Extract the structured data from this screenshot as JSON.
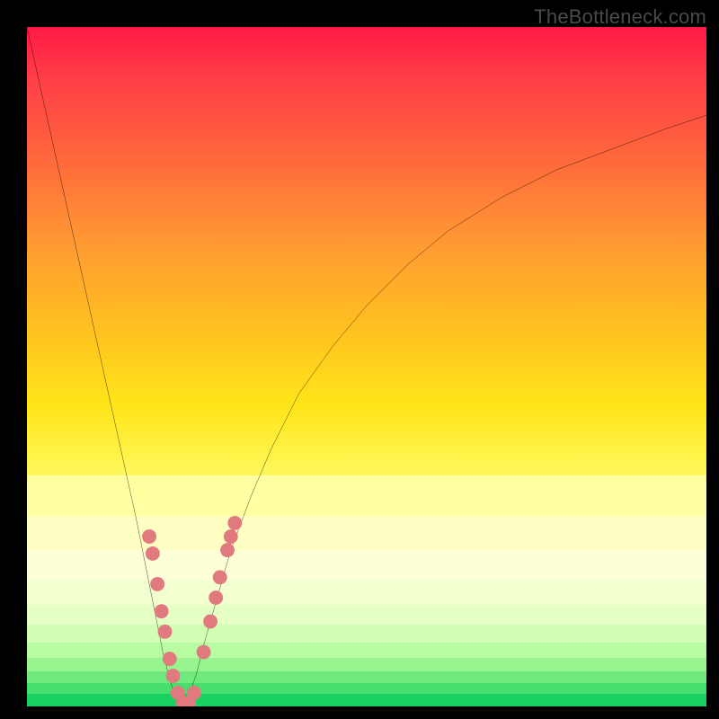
{
  "attribution": "TheBottleneck.com",
  "chart_data": {
    "type": "line",
    "title": "",
    "xlabel": "",
    "ylabel": "",
    "xlim": [
      0,
      100
    ],
    "ylim": [
      0,
      100
    ],
    "grid": false,
    "legend": false,
    "series": [
      {
        "name": "left-curve",
        "x": [
          0,
          2,
          4,
          6,
          8,
          10,
          12,
          14,
          16,
          18,
          19,
          20,
          21,
          22,
          23
        ],
        "y": [
          100,
          91,
          82,
          73,
          64,
          55,
          46,
          37,
          28,
          18,
          13,
          8,
          4,
          1,
          0
        ]
      },
      {
        "name": "right-curve",
        "x": [
          23,
          24,
          25,
          26,
          28,
          30,
          33,
          36,
          40,
          45,
          50,
          56,
          62,
          70,
          78,
          86,
          94,
          100
        ],
        "y": [
          0,
          2,
          5,
          9,
          16,
          23,
          31,
          38,
          46,
          53,
          59,
          65,
          70,
          75,
          79,
          82,
          85,
          87
        ]
      }
    ],
    "markers": {
      "name": "data-points",
      "color": "#e17a7f",
      "radius_pct": 1.05,
      "points": [
        {
          "x": 18.0,
          "y": 25.0
        },
        {
          "x": 18.5,
          "y": 22.5
        },
        {
          "x": 19.2,
          "y": 18.0
        },
        {
          "x": 19.8,
          "y": 14.0
        },
        {
          "x": 20.3,
          "y": 11.0
        },
        {
          "x": 21.0,
          "y": 7.0
        },
        {
          "x": 21.5,
          "y": 4.5
        },
        {
          "x": 22.2,
          "y": 2.0
        },
        {
          "x": 23.0,
          "y": 0.5
        },
        {
          "x": 23.8,
          "y": 0.5
        },
        {
          "x": 24.6,
          "y": 2.0
        },
        {
          "x": 26.0,
          "y": 8.0
        },
        {
          "x": 27.0,
          "y": 12.5
        },
        {
          "x": 27.8,
          "y": 16.0
        },
        {
          "x": 28.4,
          "y": 19.0
        },
        {
          "x": 29.5,
          "y": 23.0
        },
        {
          "x": 30.0,
          "y": 25.0
        },
        {
          "x": 30.6,
          "y": 27.0
        }
      ]
    },
    "gradient_bands": [
      {
        "top_pct": 66.0,
        "height_pct": 6.0,
        "color": "#fffea0"
      },
      {
        "top_pct": 72.0,
        "height_pct": 5.0,
        "color": "#ffffc4"
      },
      {
        "top_pct": 77.0,
        "height_pct": 4.5,
        "color": "#fdffd6"
      },
      {
        "top_pct": 81.5,
        "height_pct": 3.5,
        "color": "#f4ffd0"
      },
      {
        "top_pct": 85.0,
        "height_pct": 3.0,
        "color": "#e6ffc4"
      },
      {
        "top_pct": 88.0,
        "height_pct": 2.6,
        "color": "#d2ffb4"
      },
      {
        "top_pct": 90.6,
        "height_pct": 2.2,
        "color": "#b8fba0"
      },
      {
        "top_pct": 92.8,
        "height_pct": 2.0,
        "color": "#98f48e"
      },
      {
        "top_pct": 94.8,
        "height_pct": 1.8,
        "color": "#70ea7c"
      },
      {
        "top_pct": 96.6,
        "height_pct": 1.6,
        "color": "#46df6e"
      },
      {
        "top_pct": 98.2,
        "height_pct": 1.8,
        "color": "#18d160"
      }
    ]
  }
}
